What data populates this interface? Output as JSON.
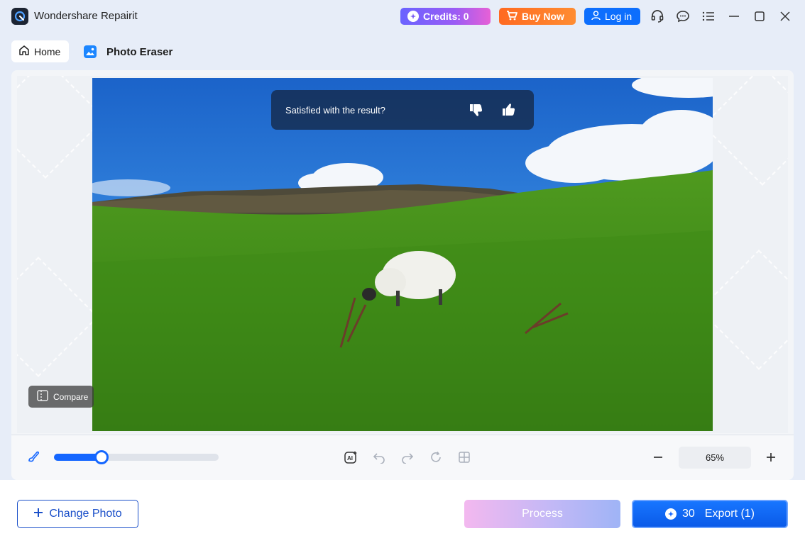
{
  "titlebar": {
    "app_title": "Wondershare Repairit",
    "credits_label": "Credits: 0",
    "buy_label": "Buy Now",
    "login_label": "Log in",
    "icons": [
      "headset-icon",
      "chat-icon",
      "menu-icon",
      "minimize-icon",
      "maximize-icon",
      "close-icon"
    ]
  },
  "breadcrumb": {
    "home_label": "Home",
    "current_title": "Photo Eraser"
  },
  "canvas": {
    "feedback_prompt": "Satisfied with the result?",
    "compare_label": "Compare"
  },
  "toolbar": {
    "brush_size_fraction": 0.29,
    "zoom_value": "65%"
  },
  "bottom": {
    "change_photo_label": "Change Photo",
    "process_label": "Process",
    "export_cost": "30",
    "export_label": "Export (1)"
  },
  "colors": {
    "accent": "#1466ff",
    "credits_gradient_start": "#6a63ff",
    "buy_now": "#ff7a28",
    "login": "#0d6efd"
  }
}
